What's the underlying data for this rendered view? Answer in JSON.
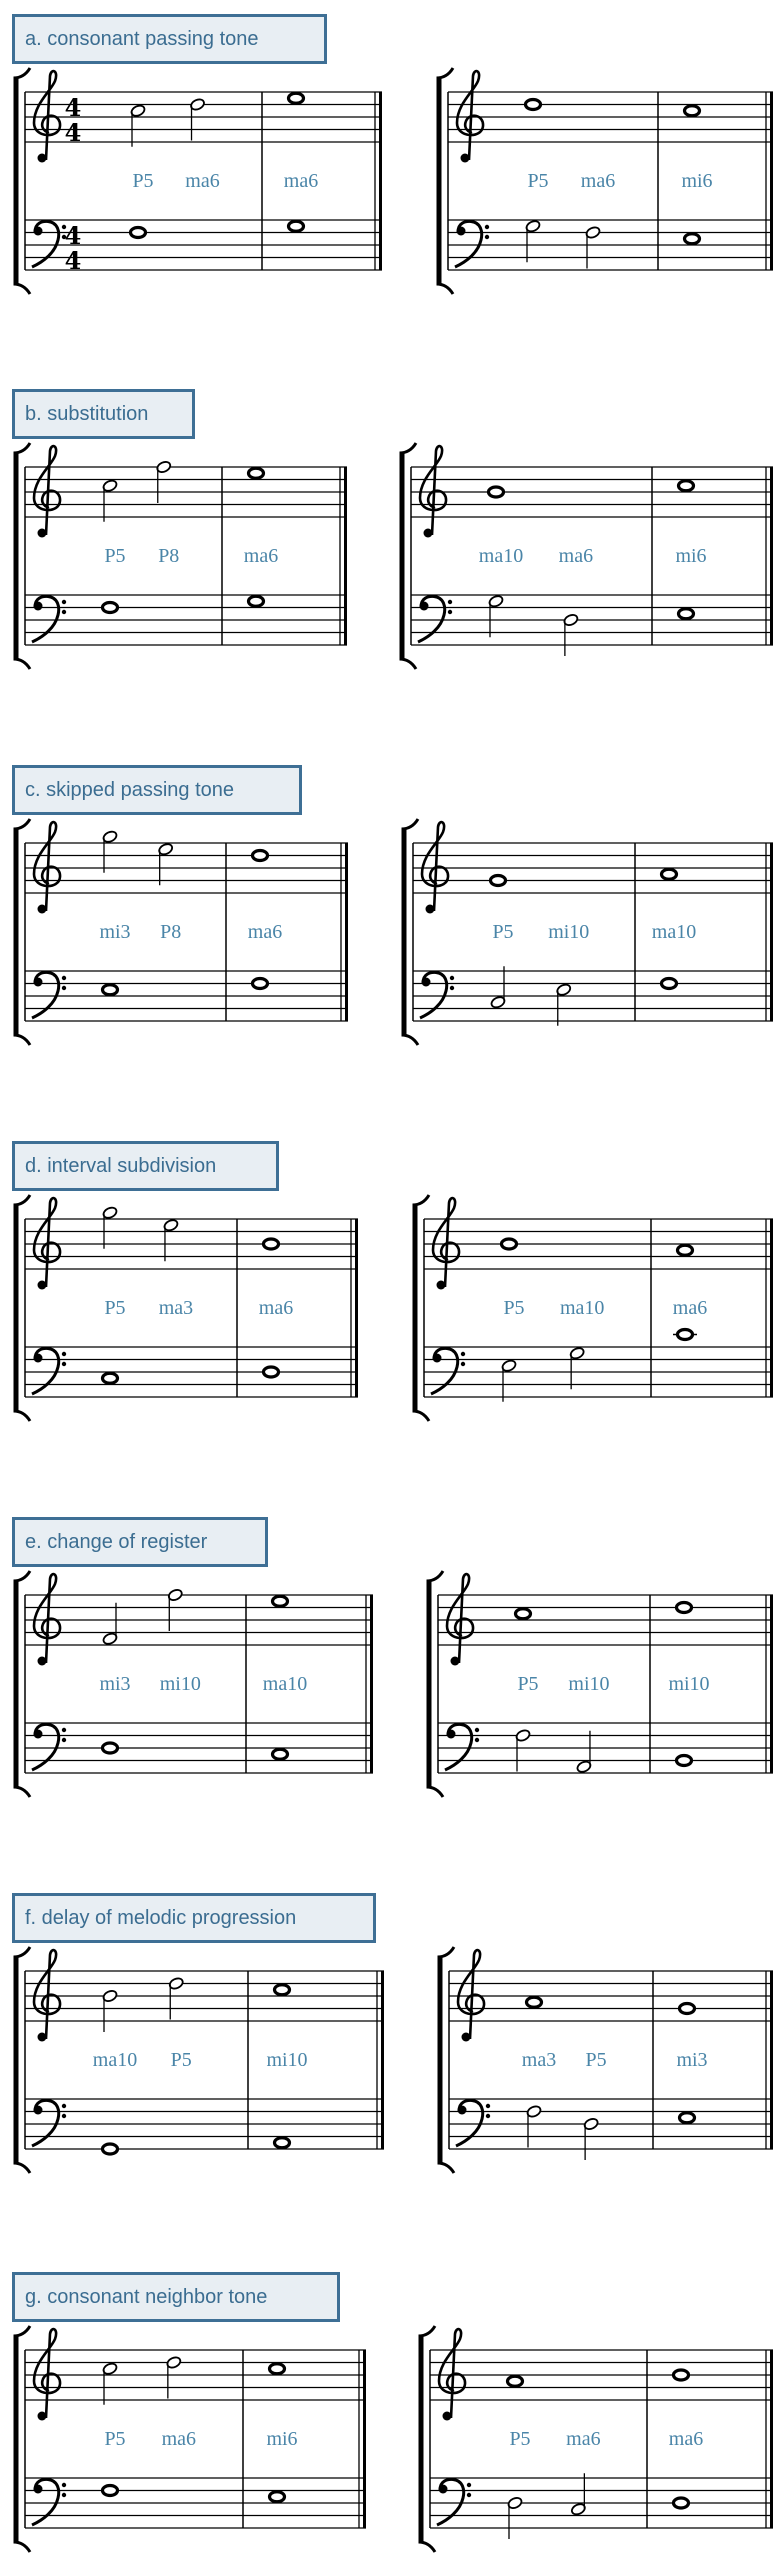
{
  "colors": {
    "label_border": "#3e6f95",
    "label_background": "#e8eef3",
    "label_text": "#3b6d91",
    "interval_text": "#4a85a8"
  },
  "sections": [
    {
      "label": "a. consonant passing tone",
      "systems": [
        {
          "time_signature": [
            "4",
            "4"
          ],
          "treble": [
            [
              "C5",
              "D5"
            ],
            [
              "E5"
            ]
          ],
          "bass": [
            [
              "F3"
            ],
            [
              "G3"
            ]
          ],
          "intervals": [
            [
              "P5",
              "ma6"
            ],
            [
              "ma6"
            ]
          ]
        },
        {
          "treble": [
            [
              "D5"
            ],
            [
              "C5"
            ]
          ],
          "bass": [
            [
              "G3",
              "F3"
            ],
            [
              "E3"
            ]
          ],
          "intervals": [
            [
              "P5",
              "ma6"
            ],
            [
              "mi6"
            ]
          ]
        }
      ]
    },
    {
      "label": "b. substitution",
      "systems": [
        {
          "treble": [
            [
              "C5",
              "F5"
            ],
            [
              "E5"
            ]
          ],
          "bass": [
            [
              "F3"
            ],
            [
              "G3"
            ]
          ],
          "intervals": [
            [
              "P5",
              "P8"
            ],
            [
              "ma6"
            ]
          ]
        },
        {
          "treble": [
            [
              "B4"
            ],
            [
              "C5"
            ]
          ],
          "bass": [
            [
              "G3",
              "D3"
            ],
            [
              "E3"
            ]
          ],
          "intervals": [
            [
              "ma10",
              "ma6"
            ],
            [
              "mi6"
            ]
          ]
        }
      ]
    },
    {
      "label": "c. skipped passing tone",
      "systems": [
        {
          "treble": [
            [
              "G5",
              "E5"
            ],
            [
              "D5"
            ]
          ],
          "bass": [
            [
              "E3"
            ],
            [
              "F3"
            ]
          ],
          "intervals": [
            [
              "mi3",
              "P8"
            ],
            [
              "ma6"
            ]
          ]
        },
        {
          "treble": [
            [
              "G4"
            ],
            [
              "A4"
            ]
          ],
          "bass": [
            [
              "C3",
              "E3"
            ],
            [
              "F3"
            ]
          ],
          "intervals": [
            [
              "P5",
              "mi10"
            ],
            [
              "ma10"
            ]
          ]
        }
      ]
    },
    {
      "label": "d. interval subdivision",
      "systems": [
        {
          "treble": [
            [
              "G5",
              "E5"
            ],
            [
              "B4"
            ]
          ],
          "bass": [
            [
              "C3"
            ],
            [
              "D3"
            ]
          ],
          "intervals": [
            [
              "P5",
              "ma3"
            ],
            [
              "ma6"
            ]
          ]
        },
        {
          "treble": [
            [
              "B4"
            ],
            [
              "A4"
            ]
          ],
          "bass": [
            [
              "E3",
              "G3"
            ],
            [
              "C4"
            ]
          ],
          "intervals": [
            [
              "P5",
              "ma10"
            ],
            [
              "ma6"
            ]
          ]
        }
      ]
    },
    {
      "label": "e. change of register",
      "systems": [
        {
          "treble": [
            [
              "F4",
              "F5"
            ],
            [
              "E5"
            ]
          ],
          "bass": [
            [
              "D3"
            ],
            [
              "C3"
            ]
          ],
          "intervals": [
            [
              "mi3",
              "mi10"
            ],
            [
              "ma10"
            ]
          ]
        },
        {
          "treble": [
            [
              "C5"
            ],
            [
              "D5"
            ]
          ],
          "bass": [
            [
              "F3",
              "A2"
            ],
            [
              "B2"
            ]
          ],
          "intervals": [
            [
              "P5",
              "mi10"
            ],
            [
              "mi10"
            ]
          ]
        }
      ]
    },
    {
      "label": "f. delay of melodic progression",
      "systems": [
        {
          "treble": [
            [
              "B4",
              "D5"
            ],
            [
              "C5"
            ]
          ],
          "bass": [
            [
              "G2"
            ],
            [
              "A2"
            ]
          ],
          "intervals": [
            [
              "ma10",
              "P5"
            ],
            [
              "mi10"
            ]
          ]
        },
        {
          "treble": [
            [
              "A4"
            ],
            [
              "G4"
            ]
          ],
          "bass": [
            [
              "F3",
              "D3"
            ],
            [
              "E3"
            ]
          ],
          "intervals": [
            [
              "ma3",
              "P5"
            ],
            [
              "mi3"
            ]
          ]
        }
      ]
    },
    {
      "label": "g. consonant neighbor tone",
      "systems": [
        {
          "treble": [
            [
              "C5",
              "D5"
            ],
            [
              "C5"
            ]
          ],
          "bass": [
            [
              "F3"
            ],
            [
              "E3"
            ]
          ],
          "intervals": [
            [
              "P5",
              "ma6"
            ],
            [
              "mi6"
            ]
          ]
        },
        {
          "treble": [
            [
              "A4"
            ],
            [
              "B4"
            ]
          ],
          "bass": [
            [
              "D3",
              "C3"
            ],
            [
              "D3"
            ]
          ],
          "intervals": [
            [
              "P5",
              "ma6"
            ],
            [
              "ma6"
            ]
          ]
        }
      ]
    }
  ]
}
